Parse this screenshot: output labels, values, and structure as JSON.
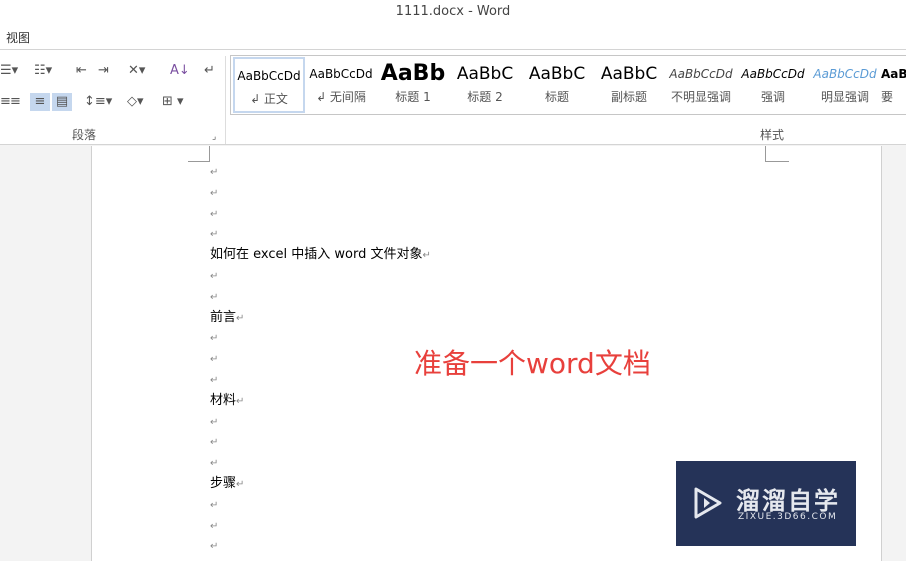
{
  "window": {
    "title": "1111.docx - Word"
  },
  "menu": {
    "view": "视图"
  },
  "ribbon": {
    "paragraph_group": "段落",
    "styles_group": "样式",
    "styles": [
      {
        "preview": "AaBbCcDd",
        "name": "↲ 正文"
      },
      {
        "preview": "AaBbCcDd",
        "name": "↲ 无间隔"
      },
      {
        "preview": "AaBb",
        "name": "标题 1"
      },
      {
        "preview": "AaBbC",
        "name": "标题 2"
      },
      {
        "preview": "AaBbC",
        "name": "标题"
      },
      {
        "preview": "AaBbC",
        "name": "副标题"
      },
      {
        "preview": "AaBbCcDd",
        "name": "不明显强调"
      },
      {
        "preview": "AaBbCcDd",
        "name": "强调"
      },
      {
        "preview": "AaBbCcDd",
        "name": "明显强调"
      },
      {
        "preview": "AaB",
        "name": "要"
      }
    ]
  },
  "document": {
    "lines": [
      "",
      "",
      "",
      "",
      "如何在 excel 中插入 word 文件对象",
      "",
      "",
      "前言",
      "",
      "",
      "",
      "材料",
      "",
      "",
      "",
      "步骤",
      "",
      "",
      ""
    ],
    "annotation": "准备一个word文档"
  },
  "watermark": {
    "brand": "溜溜自学",
    "url": "ZIXUE.3D66.COM"
  }
}
